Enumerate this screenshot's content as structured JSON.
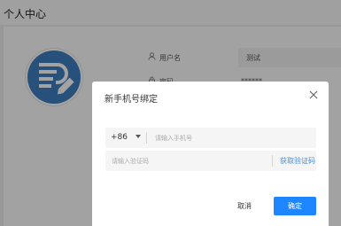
{
  "header": {
    "title": "个人中心"
  },
  "profile": {
    "username_label": "用户名",
    "username_value": "测试",
    "password_label": "密码",
    "password_value": "******",
    "user_icon": "user-icon",
    "lock_icon": "lock-icon",
    "avatar_icon": "document-edit-icon"
  },
  "modal": {
    "title": "新手机号绑定",
    "close_icon": "close-icon",
    "country_code": "+86",
    "phone_placeholder": "请输入手机号",
    "code_placeholder": "请输入验证码",
    "get_code_label": "获取验证码",
    "cancel_label": "取消",
    "confirm_label": "确定"
  },
  "colors": {
    "primary": "#1e86ff",
    "link": "#4a8fd8",
    "avatar_blue": "#3d7fc1"
  }
}
